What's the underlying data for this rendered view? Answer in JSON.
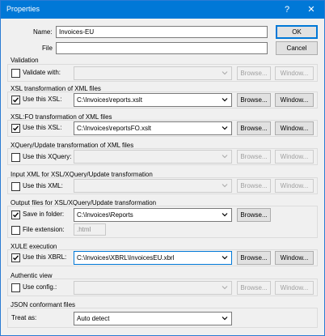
{
  "window": {
    "title": "Properties",
    "help_glyph": "?",
    "close_glyph": "✕"
  },
  "name_label": "Name:",
  "name_value": "Invoices-EU",
  "file_label": "File",
  "file_value": "",
  "ok_label": "OK",
  "cancel_label": "Cancel",
  "browse_label": "Browse...",
  "window_label": "Window...",
  "validation": {
    "title": "Validation",
    "checkbox_label": "Validate with:",
    "checked": false,
    "value": ""
  },
  "xsl": {
    "title": "XSL transformation of XML files",
    "checkbox_label": "Use this XSL:",
    "checked": true,
    "value": "C:\\Invoices\\reports.xslt"
  },
  "xslfo": {
    "title": "XSL:FO transformation of XML files",
    "checkbox_label": "Use this XSL:",
    "checked": true,
    "value": "C:\\Invoices\\reportsFO.xslt"
  },
  "xquery": {
    "title": "XQuery/Update transformation of XML files",
    "checkbox_label": "Use this XQuery:",
    "checked": false,
    "value": ""
  },
  "input_xml": {
    "title": "Input XML for XSL/XQuery/Update transformation",
    "checkbox_label": "Use this XML:",
    "checked": false,
    "value": ""
  },
  "output": {
    "title": "Output files for XSL/XQuery/Update transformation",
    "save_label": "Save in folder:",
    "save_checked": true,
    "save_value": "C:\\Invoices\\Reports",
    "ext_label": "File extension:",
    "ext_checked": false,
    "ext_value": ".html"
  },
  "xule": {
    "title": "XULE execution",
    "checkbox_label": "Use this XBRL:",
    "checked": true,
    "value": "C:\\Invoices\\XBRL\\InvoicesEU.xbrl"
  },
  "authentic": {
    "title": "Authentic view",
    "checkbox_label": "Use config.:",
    "checked": false,
    "value": ""
  },
  "json": {
    "title": "JSON conformant files",
    "treat_label": "Treat as:",
    "treat_value": "Auto detect"
  },
  "colors": {
    "titlebar": "#0078d7",
    "dialog_bg": "#f0f0f0",
    "check": "#000000"
  },
  "icons": {
    "check": "checkmark-icon",
    "arrow": "chevron-down-icon",
    "help": "help-icon",
    "close": "close-icon"
  }
}
